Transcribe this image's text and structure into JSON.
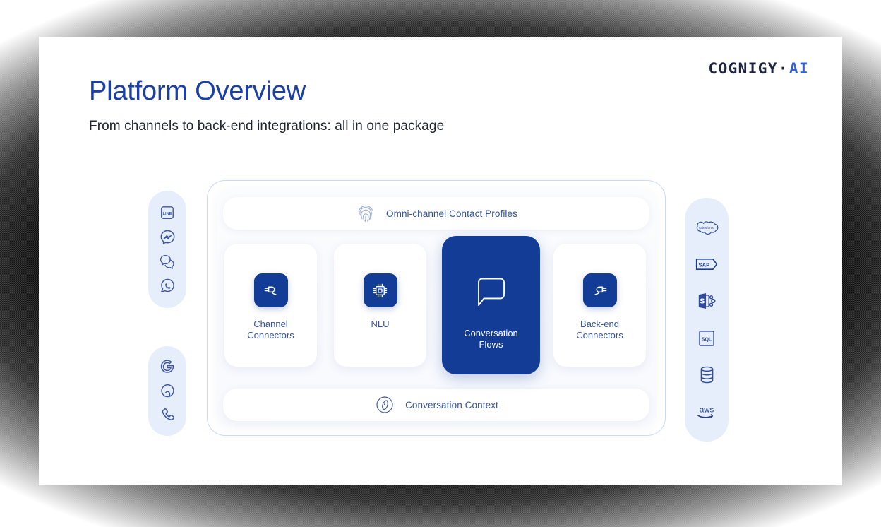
{
  "logo": {
    "word": "COGNIGY",
    "separator": "·",
    "suffix": "AI"
  },
  "header": {
    "title": "Platform Overview",
    "subtitle": "From channels to back-end integrations: all in one package"
  },
  "colors": {
    "accent_blue": "#123c96",
    "title_blue": "#1a3fa8",
    "label_blue": "#33539e",
    "pill_background": "#e7eefb",
    "container_border": "#cbd9f5",
    "slide_background": "#ffffff"
  },
  "diagram": {
    "channels_top": {
      "items": [
        {
          "icon": "line-messenger-icon",
          "label": "LINE"
        },
        {
          "icon": "facebook-messenger-icon",
          "label": "Facebook Messenger"
        },
        {
          "icon": "webchat-bubbles-icon",
          "label": "Webchat"
        },
        {
          "icon": "whatsapp-icon",
          "label": "WhatsApp"
        }
      ]
    },
    "channels_bottom": {
      "items": [
        {
          "icon": "google-assistant-icon",
          "label": "Google"
        },
        {
          "icon": "alexa-icon",
          "label": "Alexa"
        },
        {
          "icon": "phone-handset-icon",
          "label": "Voice"
        }
      ]
    },
    "integrations": {
      "items": [
        {
          "icon": "salesforce-icon",
          "label": "salesforce"
        },
        {
          "icon": "sap-icon",
          "label": "SAP"
        },
        {
          "icon": "sharepoint-icon",
          "label": "SharePoint"
        },
        {
          "icon": "sql-icon",
          "label": "SQL"
        },
        {
          "icon": "database-icon",
          "label": "Database"
        },
        {
          "icon": "aws-icon",
          "label": "aws"
        }
      ]
    },
    "top_bar": {
      "icon": "fingerprint-icon",
      "label": "Omni-channel Contact Profiles"
    },
    "bottom_bar": {
      "icon": "compass-icon",
      "label": "Conversation Context"
    },
    "cards": [
      {
        "icon": "plug-in-icon",
        "label": "Channel\nConnectors",
        "highlighted": false
      },
      {
        "icon": "cpu-chip-icon",
        "label": "NLU",
        "highlighted": false
      },
      {
        "icon": "speech-bubble-icon",
        "label": "Conversation\nFlows",
        "highlighted": true
      },
      {
        "icon": "plug-out-icon",
        "label": "Back-end\nConnectors",
        "highlighted": false
      }
    ]
  }
}
